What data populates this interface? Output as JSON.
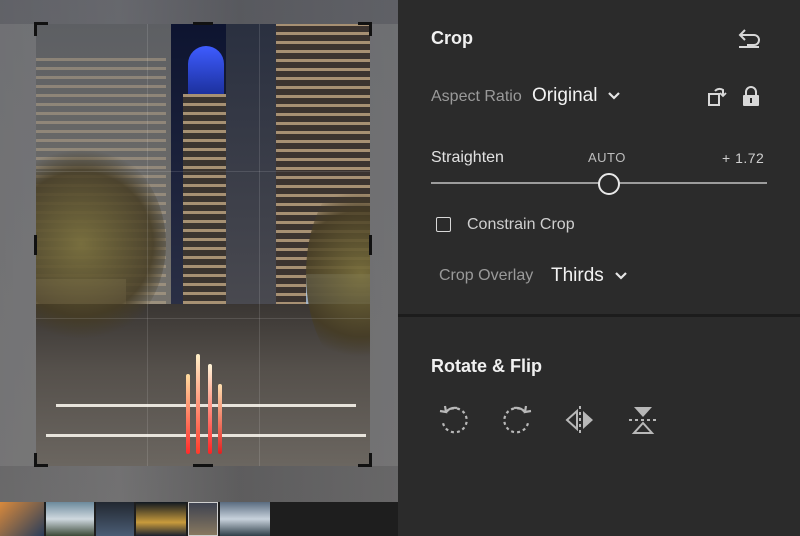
{
  "panel": {
    "crop": {
      "title": "Crop",
      "reset_icon": "reset-icon",
      "aspect_ratio": {
        "label": "Aspect Ratio",
        "value": "Original",
        "orientation_icon": "rotate-orientation-icon",
        "lock_icon": "lock-icon"
      },
      "straighten": {
        "label": "Straighten",
        "auto_label": "AUTO",
        "value_text": "+ 1.72",
        "value": 1.72,
        "slider_fraction": 0.53
      },
      "constrain_crop": {
        "label": "Constrain Crop",
        "checked": false
      },
      "crop_overlay": {
        "label": "Crop Overlay",
        "value": "Thirds"
      }
    },
    "rotate_flip": {
      "title": "Rotate & Flip",
      "buttons": [
        {
          "name": "rotate-left",
          "icon": "rotate-left-icon"
        },
        {
          "name": "rotate-right",
          "icon": "rotate-right-icon"
        },
        {
          "name": "flip-horizontal",
          "icon": "flip-horizontal-icon"
        },
        {
          "name": "flip-vertical",
          "icon": "flip-vertical-icon"
        }
      ]
    }
  },
  "colors": {
    "panel_bg": "#2b2b2b",
    "divider": "#1c1c1c",
    "text": "#e6e6e6",
    "text_dim": "#9a9a9a"
  }
}
